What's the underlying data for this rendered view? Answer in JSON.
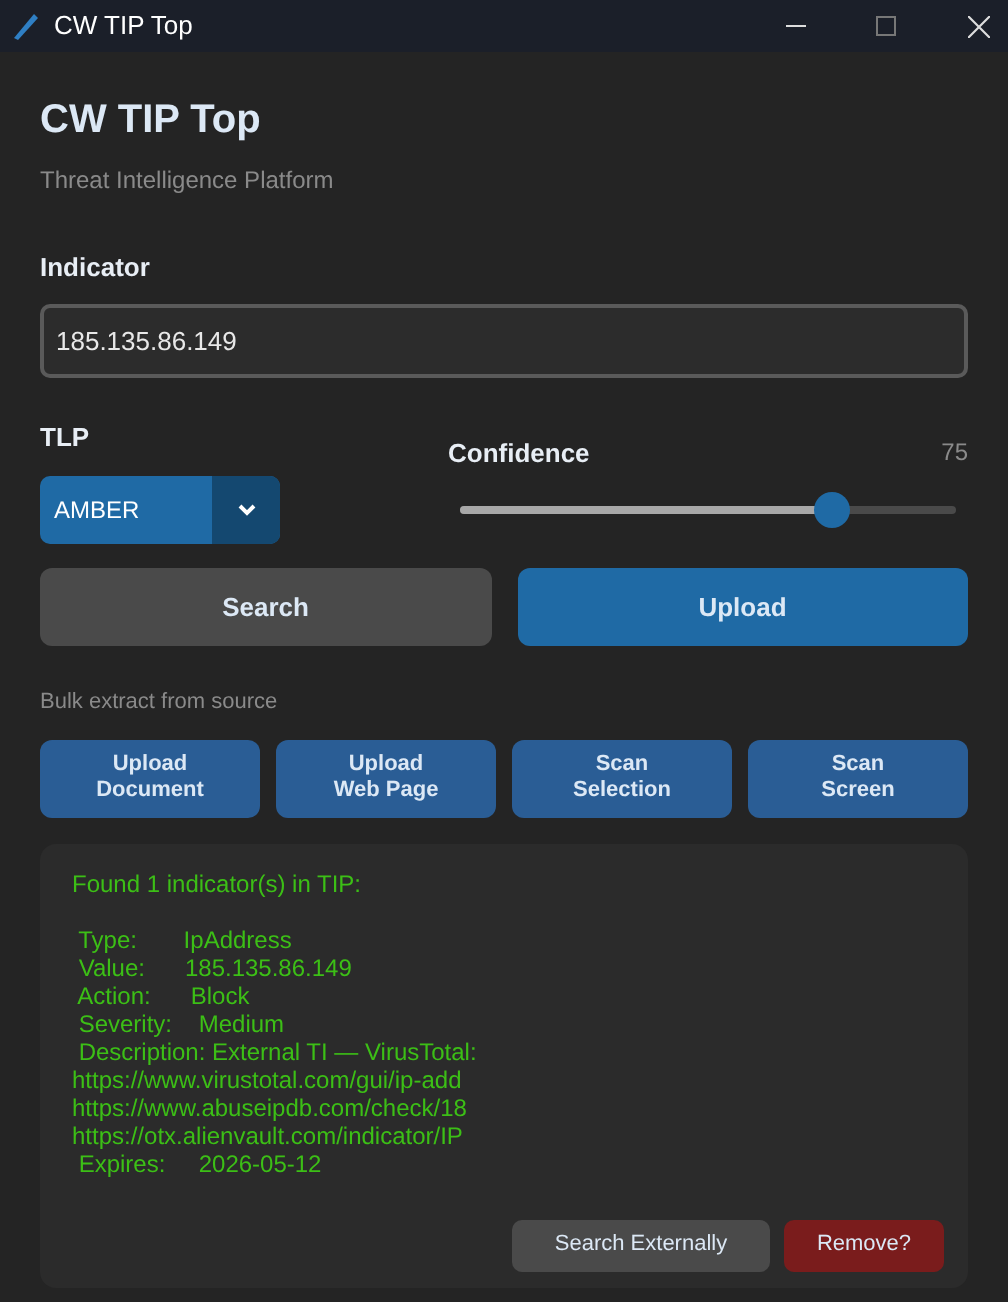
{
  "window": {
    "title": "CW TIP Top"
  },
  "header": {
    "title": "CW TIP Top",
    "subtitle": "Threat Intelligence Platform"
  },
  "indicator": {
    "label": "Indicator",
    "value": "185.135.86.149"
  },
  "tlp": {
    "label": "TLP",
    "value": "AMBER"
  },
  "confidence": {
    "label": "Confidence",
    "reading": "75",
    "level": 0.75
  },
  "actions": [
    "Search",
    "Upload"
  ],
  "bulk": {
    "label": "Bulk extract from source",
    "buttons": [
      "Upload\nDocument",
      "Upload\nWeb Page",
      "Scan\nSelection",
      "Scan\nScreen"
    ]
  },
  "result": {
    "lines": [
      "Found 1 indicator(s) in TIP:",
      " Type:       IpAddress",
      " Value:      185.135.86.149",
      " Action:      Block",
      " Severity:    Medium",
      " Description: External TI — VirusTotal:",
      "https://www.virustotal.com/gui/ip-add",
      "https://www.abuseipdb.com/check/18",
      "https://otx.alienvault.com/indicator/IP",
      " Expires:     2026-05-12"
    ],
    "buttons": [
      {
        "label": "Search Externally",
        "kind": "neutral"
      },
      {
        "label": "Remove?",
        "kind": "danger"
      }
    ]
  }
}
